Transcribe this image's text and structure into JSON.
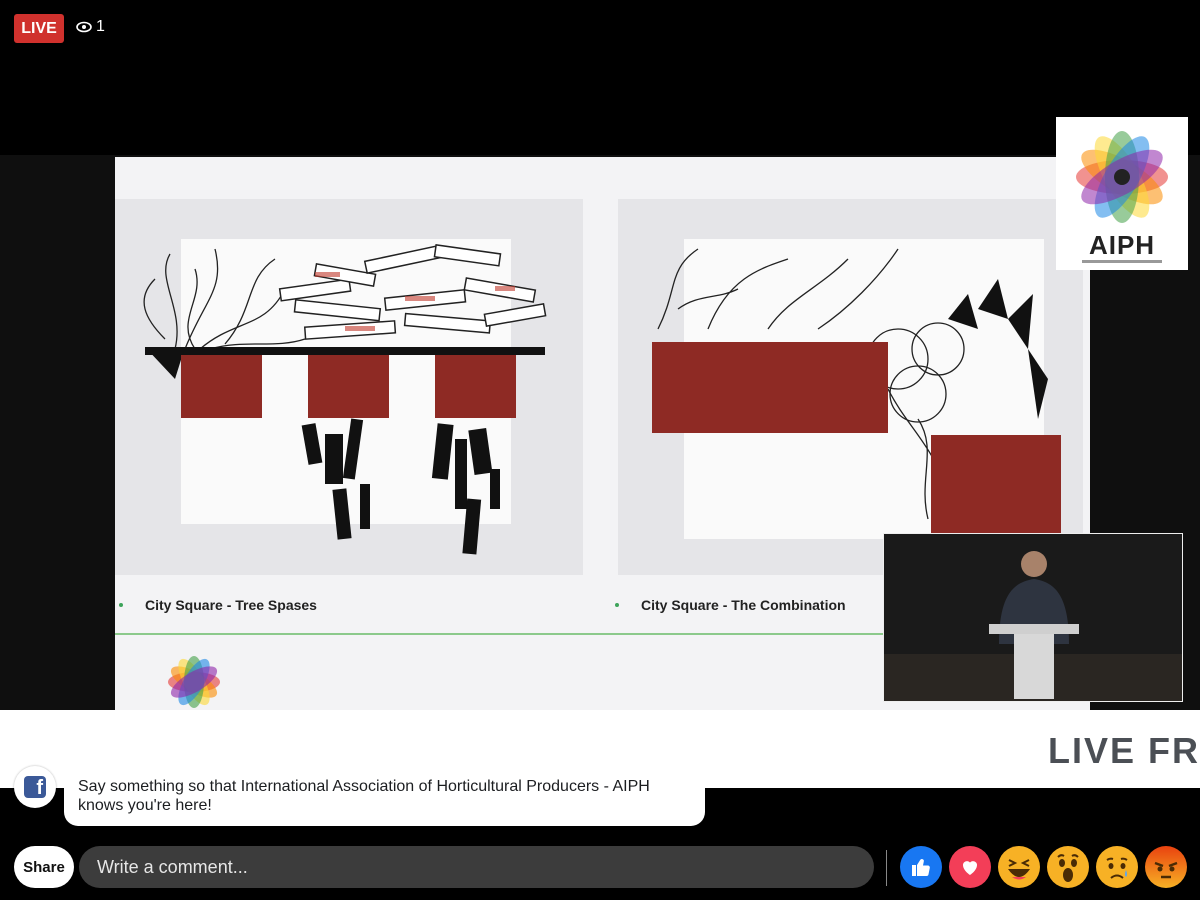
{
  "live": {
    "label": "LIVE",
    "viewer_count": "1",
    "viewer_icon": "eye-icon"
  },
  "slide": {
    "captions": [
      "City Square - Tree Spases",
      "City Square - The Combination"
    ]
  },
  "overlay_logo": {
    "text": "AIPH"
  },
  "banner": {
    "text": "LIVE FR"
  },
  "prompt": {
    "text": "Say something so that International Association of Horticultural Producers - AIPH knows you're here!",
    "icon": "facebook-icon"
  },
  "composer": {
    "share_label": "Share",
    "placeholder": "Write a comment..."
  },
  "reactions": [
    {
      "name": "like",
      "icon": "thumbs-up-icon",
      "color": "#1877f2"
    },
    {
      "name": "love",
      "icon": "heart-icon",
      "color": "#f33e58"
    },
    {
      "name": "haha",
      "icon": "laughing-face-icon",
      "color": "#f7b125"
    },
    {
      "name": "wow",
      "icon": "surprised-face-icon",
      "color": "#f7b125"
    },
    {
      "name": "sad",
      "icon": "sad-face-icon",
      "color": "#f7b125"
    },
    {
      "name": "angry",
      "icon": "angry-face-icon",
      "color": "#e9710f"
    }
  ],
  "colors": {
    "live_red": "#d0312d",
    "fb_blue": "#3b5998",
    "slide_green": "#8bc98b"
  }
}
